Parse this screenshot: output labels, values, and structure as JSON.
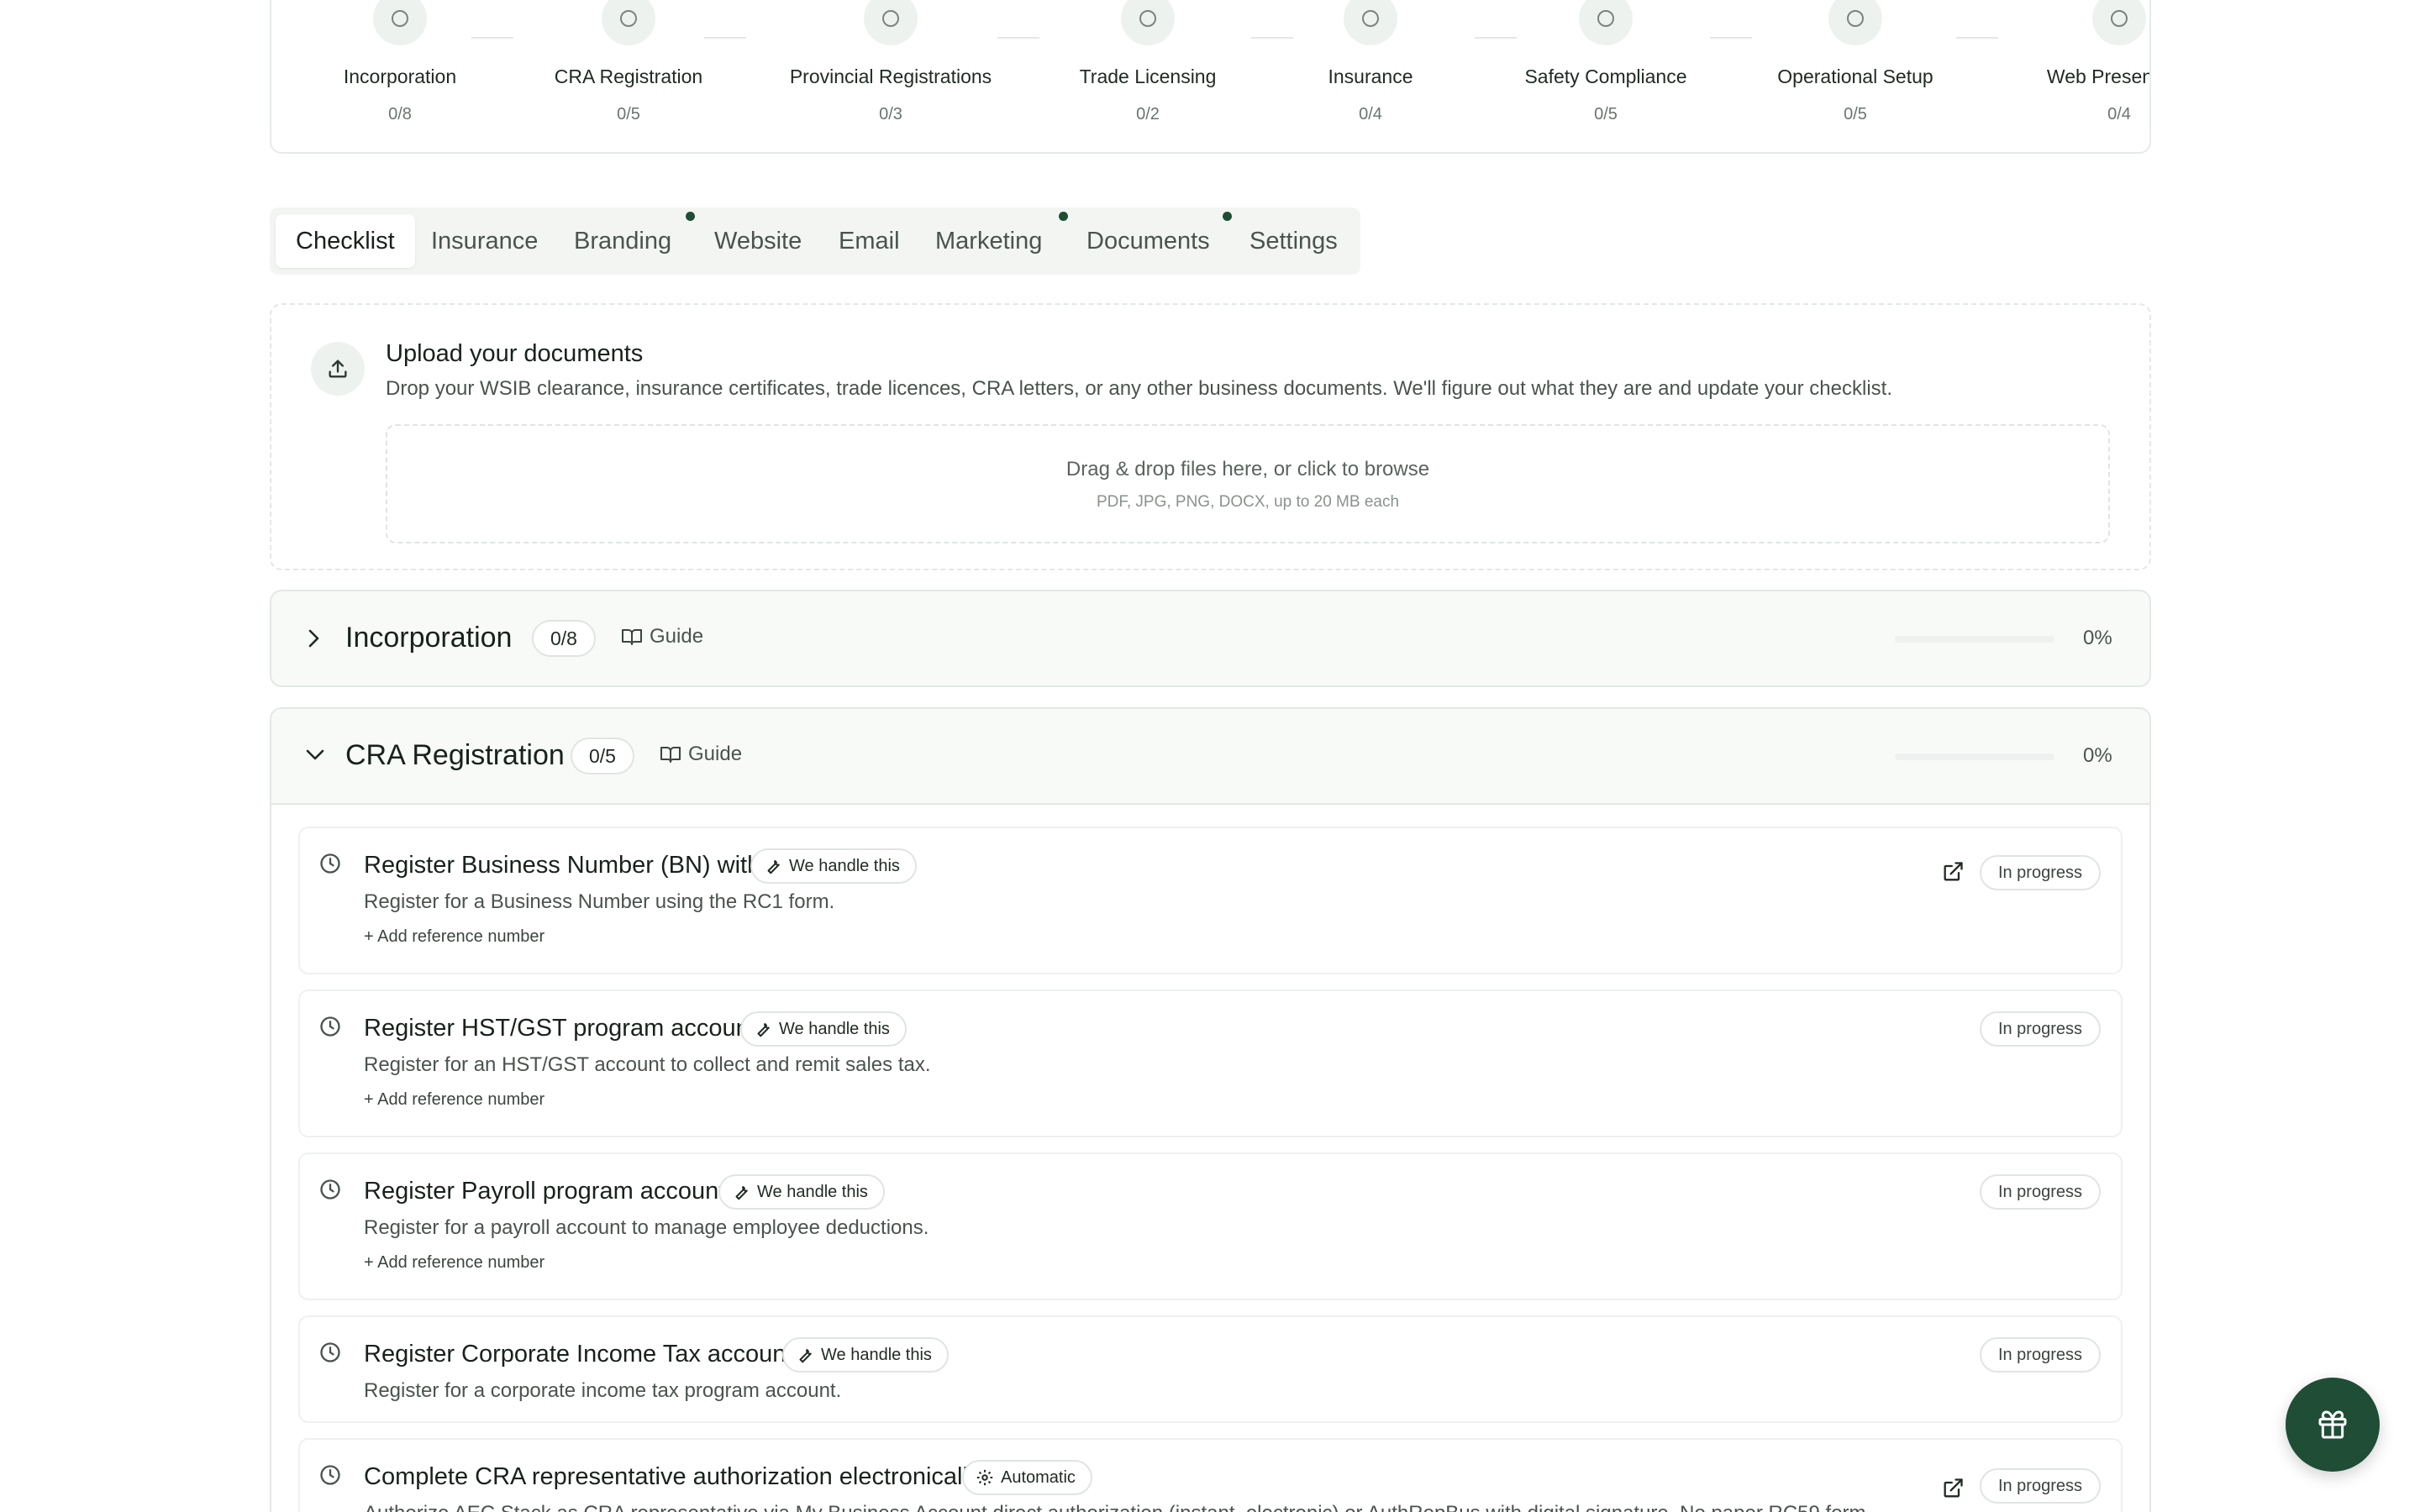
{
  "stepper": {
    "steps": [
      {
        "label": "Incorporation",
        "count": "0/8"
      },
      {
        "label": "CRA Registration",
        "count": "0/5"
      },
      {
        "label": "Provincial Registrations",
        "count": "0/3"
      },
      {
        "label": "Trade Licensing",
        "count": "0/2"
      },
      {
        "label": "Insurance",
        "count": "0/4"
      },
      {
        "label": "Safety Compliance",
        "count": "0/5"
      },
      {
        "label": "Operational Setup",
        "count": "0/5"
      },
      {
        "label": "Web Presence &",
        "count": "0/4"
      }
    ]
  },
  "tabs": [
    {
      "label": "Checklist",
      "active": true,
      "dot": false
    },
    {
      "label": "Insurance",
      "active": false,
      "dot": false
    },
    {
      "label": "Branding",
      "active": false,
      "dot": true
    },
    {
      "label": "Website",
      "active": false,
      "dot": false
    },
    {
      "label": "Email",
      "active": false,
      "dot": false
    },
    {
      "label": "Marketing",
      "active": false,
      "dot": true
    },
    {
      "label": "Documents",
      "active": false,
      "dot": true
    },
    {
      "label": "Settings",
      "active": false,
      "dot": false
    }
  ],
  "upload": {
    "title": "Upload your documents",
    "description": "Drop your WSIB clearance, insurance certificates, trade licences, CRA letters, or any other business documents. We'll figure out what they are and update your checklist.",
    "dropzone_main": "Drag & drop files here, or click to browse",
    "dropzone_sub": "PDF, JPG, PNG, DOCX, up to 20 MB each"
  },
  "sections": {
    "incorporation": {
      "title": "Incorporation",
      "count": "0/8",
      "guide": "Guide",
      "percent": "0%",
      "progress": 0
    },
    "cra": {
      "title": "CRA Registration",
      "count": "0/5",
      "guide": "Guide",
      "percent": "0%",
      "progress": 0
    }
  },
  "tasks": [
    {
      "title": "Register Business Number (BN) with CRA",
      "pill": "We handle this",
      "pill_icon": "wrench-icon",
      "desc": "Register for a Business Number using the RC1 form.",
      "ref": "+ Add reference number",
      "status": "In progress",
      "external": true
    },
    {
      "title": "Register HST/GST program account (RT)",
      "pill": "We handle this",
      "pill_icon": "wrench-icon",
      "desc": "Register for an HST/GST account to collect and remit sales tax.",
      "ref": "+ Add reference number",
      "status": "In progress",
      "external": false
    },
    {
      "title": "Register Payroll program account (RP)",
      "pill": "We handle this",
      "pill_icon": "wrench-icon",
      "desc": "Register for a payroll account to manage employee deductions.",
      "ref": "+ Add reference number",
      "status": "In progress",
      "external": false
    },
    {
      "title": "Register Corporate Income Tax account (RC)",
      "pill": "We handle this",
      "pill_icon": "wrench-icon",
      "desc": "Register for a corporate income tax program account.",
      "ref": "",
      "status": "In progress",
      "external": false
    },
    {
      "title": "Complete CRA representative authorization electronically",
      "pill": "Automatic",
      "pill_icon": "gear-icon",
      "desc": "Authorize AEC Stack as CRA representative via My Business Account direct authorization (instant, electronic) or AuthRepBus with digital signature. No paper RC59 form.",
      "ref": "",
      "status": "In progress",
      "external": true
    }
  ],
  "colors": {
    "accent": "#1f4d36",
    "border": "#e3e8e4",
    "muted": "#4a534d"
  }
}
